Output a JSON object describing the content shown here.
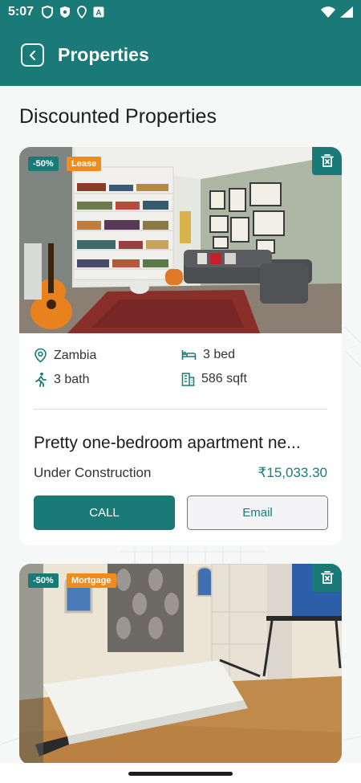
{
  "status_bar": {
    "time": "5:07"
  },
  "app_bar": {
    "title": "Properties",
    "back_icon": "chevron-left-icon"
  },
  "section": {
    "title": "Discounted Properties"
  },
  "properties": [
    {
      "discount": "-50%",
      "type": "Lease",
      "location": "Zambia",
      "beds": "3 bed",
      "baths": "3 bath",
      "area": "586 sqft",
      "title": "Pretty one-bedroom apartment ne...",
      "status": "Under Construction",
      "price": "₹15,033.30",
      "call_label": "CALL",
      "email_label": "Email"
    },
    {
      "discount": "-50%",
      "type": "Mortgage"
    }
  ],
  "colors": {
    "primary": "#1a7a78",
    "badge_orange": "#f08b1d"
  }
}
